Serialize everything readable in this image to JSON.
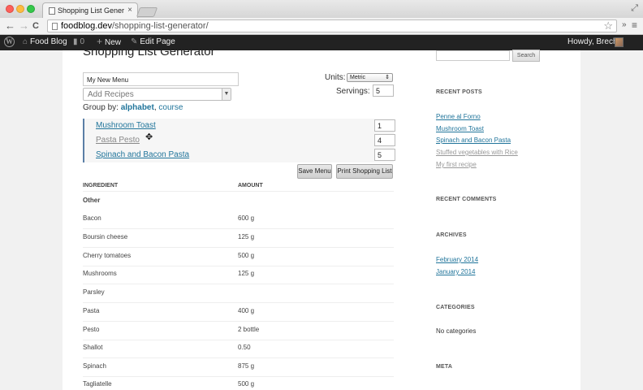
{
  "browser": {
    "tab_title": "Shopping List Generator | Fo",
    "tab_close": "×",
    "url_host": "foodblog.dev",
    "url_path": "/shopping-list-generator/",
    "back": "←",
    "forward": "→",
    "reload": "C",
    "star": "☆",
    "more": "»",
    "menu": "≡",
    "expand": "⤢"
  },
  "adminbar": {
    "site_name": "Food Blog",
    "comments_count": "0",
    "new_label": "New",
    "edit_page_label": "Edit Page",
    "howdy": "Howdy, Brecht"
  },
  "generator": {
    "title": "Shopping List Generator",
    "menu_name": "My New Menu",
    "add_recipes_placeholder": "Add Recipes",
    "group_by_label": "Group by:",
    "group_by_options": [
      "alphabet",
      "course"
    ],
    "group_by_separator": ", ",
    "units_label": "Units:",
    "units_value": "Metric",
    "servings_label": "Servings:",
    "servings_value": "5",
    "recipes": [
      {
        "name": "Mushroom Toast",
        "qty": "1"
      },
      {
        "name": "Pasta Pesto",
        "qty": "4"
      },
      {
        "name": "Spinach and Bacon Pasta",
        "qty": "5"
      }
    ],
    "save_menu_label": "Save Menu",
    "print_label": "Print Shopping List",
    "col_ingredient": "INGREDIENT",
    "col_amount": "AMOUNT",
    "group_other": "Other",
    "ingredients": [
      {
        "name": "Bacon",
        "amount": "600 g"
      },
      {
        "name": "Boursin cheese",
        "amount": "125 g"
      },
      {
        "name": "Cherry tomatoes",
        "amount": "500 g"
      },
      {
        "name": "Mushrooms",
        "amount": "125 g"
      },
      {
        "name": "Parsley",
        "amount": ""
      },
      {
        "name": "Pasta",
        "amount": "400 g"
      },
      {
        "name": "Pesto",
        "amount": "2 bottle"
      },
      {
        "name": "Shallot",
        "amount": "0.50"
      },
      {
        "name": "Spinach",
        "amount": "875 g"
      },
      {
        "name": "Tagliatelle",
        "amount": "500 g"
      }
    ]
  },
  "sidebar": {
    "search_button": "Search",
    "recent_posts_heading": "RECENT POSTS",
    "recent_posts": [
      "Penne al Forno",
      "Mushroom Toast",
      "Spinach and Bacon Pasta",
      "Stuffed vegetables with Rice",
      "My first recipe"
    ],
    "recent_comments_heading": "RECENT COMMENTS",
    "archives_heading": "ARCHIVES",
    "archives": [
      "February 2014",
      "January 2014"
    ],
    "categories_heading": "CATEGORIES",
    "categories_empty": "No categories",
    "meta_heading": "META"
  }
}
